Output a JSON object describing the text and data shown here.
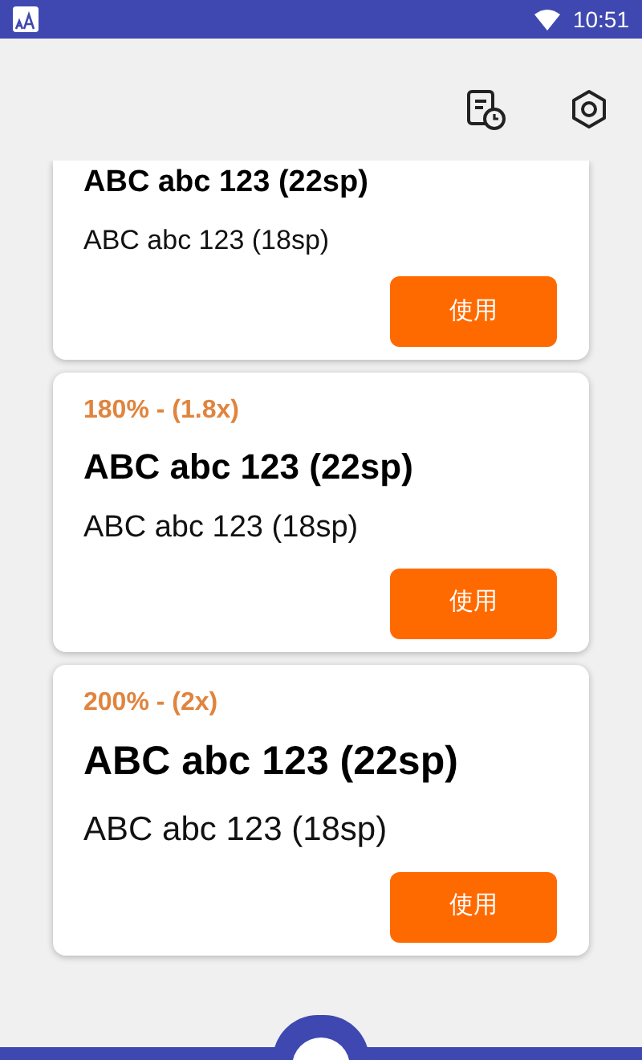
{
  "status_bar": {
    "time": "10:51"
  },
  "cards": [
    {
      "heading": "ABC abc 123 (22sp)",
      "body": "ABC abc 123 (18sp)",
      "button": "使用"
    },
    {
      "label": "180% - (1.8x)",
      "heading": "ABC abc 123 (22sp)",
      "body": "ABC abc 123 (18sp)",
      "button": "使用"
    },
    {
      "label": "200% - (2x)",
      "heading": "ABC abc 123 (22sp)",
      "body": "ABC abc 123 (18sp)",
      "button": "使用"
    }
  ]
}
